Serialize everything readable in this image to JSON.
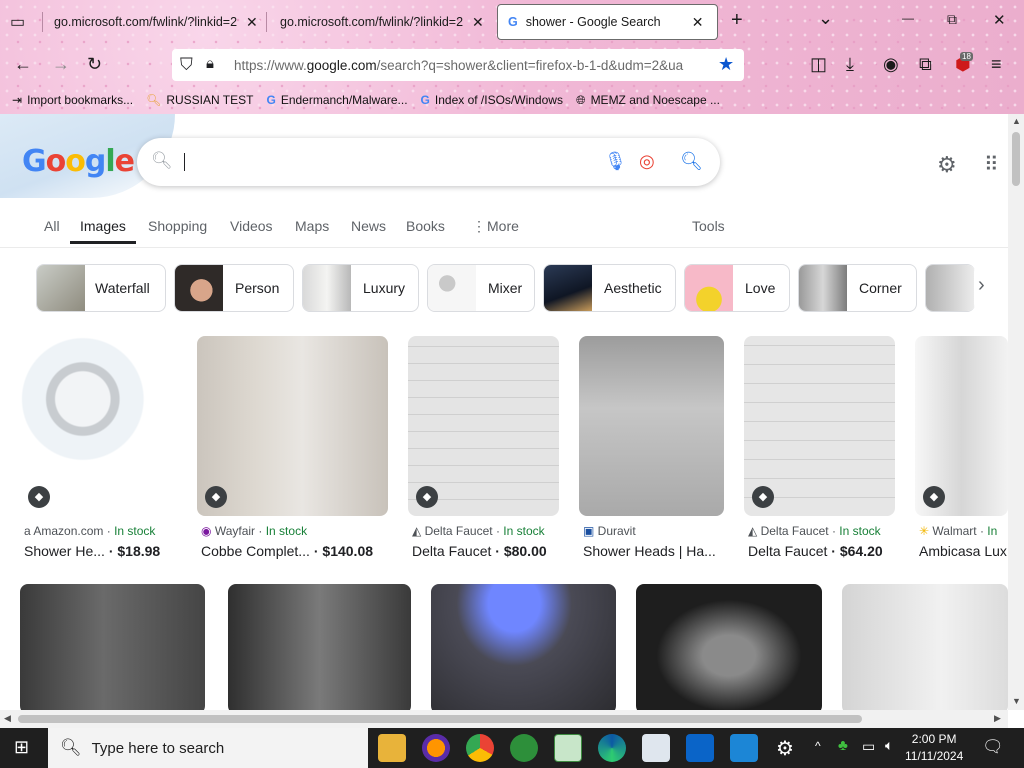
{
  "browser": {
    "tabs": [
      {
        "title": "go.microsoft.com/fwlink/?linkid=2",
        "close": "✕"
      },
      {
        "title": "go.microsoft.com/fwlink/?linkid=2",
        "close": "✕"
      },
      {
        "title": "shower - Google Search",
        "close": "✕",
        "active": true
      }
    ],
    "new_tab": "+",
    "tab_list": "⌄",
    "window_controls": {
      "minimize": "—",
      "maximize": "⧉",
      "close": "✕"
    },
    "address": {
      "prefix": "https://www.",
      "domain": "google.com",
      "path": "/search?q=shower&client=firefox-b-1-d&udm=2&ua"
    },
    "extensions_badge": "18",
    "bookmarks": [
      {
        "label": "Import bookmarks...",
        "icon": "import-icon"
      },
      {
        "label": "RUSSIAN TEST",
        "icon": "search-icon"
      },
      {
        "label": "Endermanch/Malware...",
        "icon": "google-icon"
      },
      {
        "label": "Index of /ISOs/Windows",
        "icon": "google-icon"
      },
      {
        "label": "MEMZ and Noescape ...",
        "icon": "globe-icon"
      }
    ]
  },
  "google": {
    "logo": "Google",
    "search_value": "",
    "tabs": [
      "All",
      "Images",
      "Shopping",
      "Videos",
      "Maps",
      "News",
      "Books",
      "More",
      "Tools"
    ],
    "active_tab": "Images",
    "chips": [
      "Waterfall",
      "Person",
      "Luxury",
      "Mixer",
      "Aesthetic",
      "Love",
      "Corner"
    ],
    "results_row1": [
      {
        "source": "Amazon.com",
        "stock": "In stock",
        "title": "Shower He...",
        "price": "$18.98"
      },
      {
        "source": "Wayfair",
        "stock": "In stock",
        "title": "Cobbe Complet...",
        "price": "$140.08"
      },
      {
        "source": "Delta Faucet",
        "stock": "In stock",
        "title": "Delta Faucet",
        "price": "$80.00"
      },
      {
        "source": "Duravit",
        "stock": "",
        "title": "Shower Heads | Ha...",
        "price": ""
      },
      {
        "source": "Delta Faucet",
        "stock": "In stock",
        "title": "Delta Faucet",
        "price": "$64.20"
      },
      {
        "source": "Walmart",
        "stock": "In",
        "title": "Ambicasa Lux",
        "price": ""
      }
    ]
  },
  "taskbar": {
    "search_placeholder": "Type here to search",
    "time": "2:00 PM",
    "date": "11/11/2024"
  }
}
